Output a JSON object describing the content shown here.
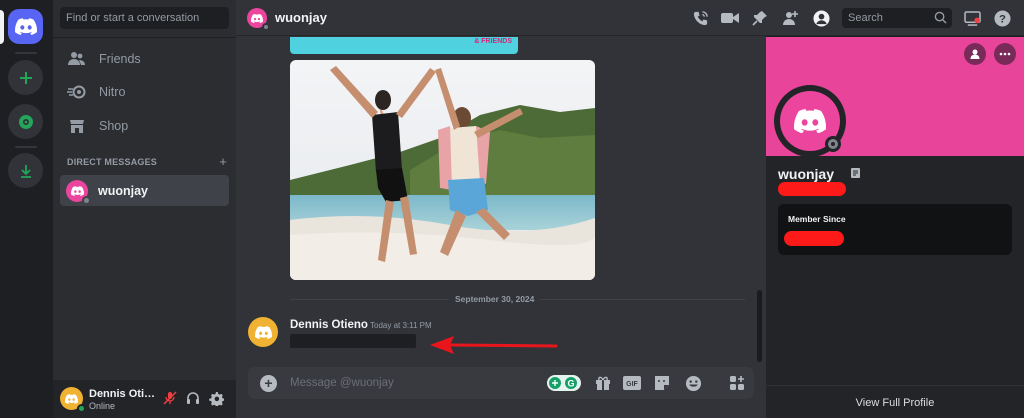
{
  "rail": {
    "items": [
      {
        "name": "home",
        "icon": "discord-logo-icon"
      },
      {
        "name": "add-server",
        "icon": "plus-icon"
      },
      {
        "name": "discover",
        "icon": "compass-icon"
      },
      {
        "name": "download-apps",
        "icon": "download-icon"
      }
    ],
    "accent": "#5865f2",
    "green": "#23a55a"
  },
  "sidebar": {
    "search_placeholder": "Find or start a conversation",
    "nav": [
      {
        "label": "Friends",
        "icon": "friends-icon"
      },
      {
        "label": "Nitro",
        "icon": "nitro-icon"
      },
      {
        "label": "Shop",
        "icon": "shop-icon"
      }
    ],
    "direct_messages_header": "DIRECT MESSAGES",
    "add_dm": "+",
    "dms": [
      {
        "name": "wuonjay",
        "status": "offline"
      }
    ]
  },
  "user_panel": {
    "name": "Dennis Oti…",
    "status": "Online"
  },
  "topbar": {
    "channel_name": "wuonjay",
    "search_placeholder": "Search",
    "icons": [
      "voice-call-icon",
      "video-call-icon",
      "pin-icon",
      "add-friends-icon",
      "user-profile-icon",
      "search-icon",
      "inbox-icon",
      "help-icon"
    ]
  },
  "chat": {
    "image_brand": "& FRIENDS",
    "date_divider": "September 30, 2024",
    "message": {
      "author": "Dennis Otieno",
      "timestamp": "Today at 3:11 PM"
    },
    "composer_placeholder": "Message @wuonjay",
    "composer_icons": [
      "plus-circle-icon",
      "grammarly-icon",
      "gift-icon",
      "gif-icon",
      "sticker-icon",
      "emoji-icon",
      "apps-icon"
    ],
    "annotation_color": "#e8161c"
  },
  "profile": {
    "username": "wuonjay",
    "banner_color": "#e8449a",
    "member_since_label": "Member Since",
    "view_full_profile": "View Full Profile"
  }
}
